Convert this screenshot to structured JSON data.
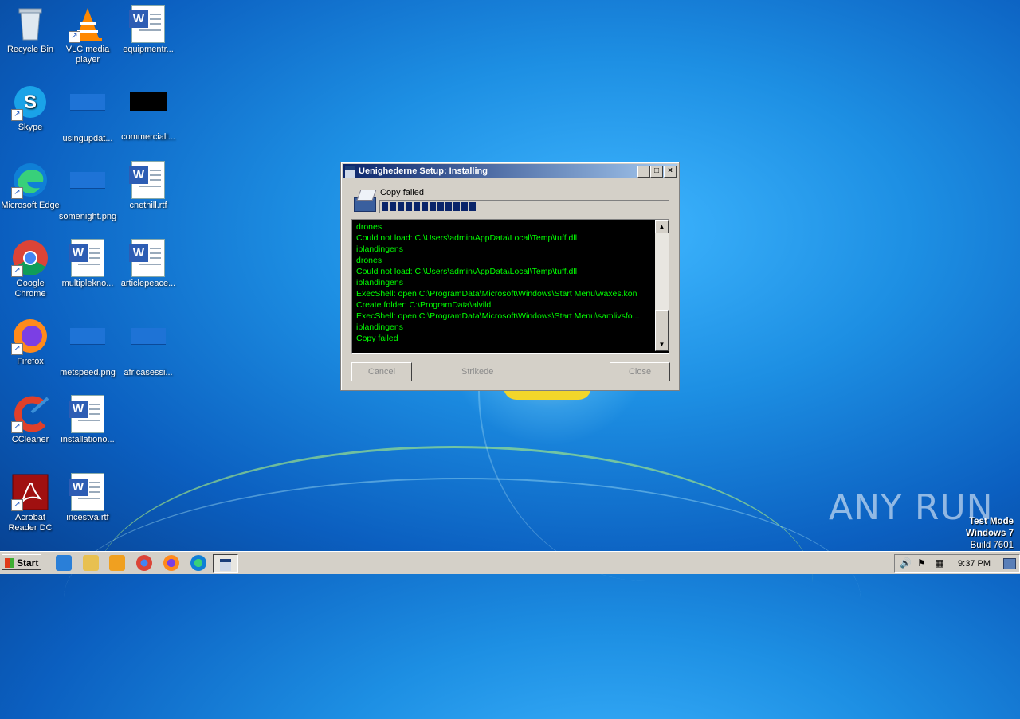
{
  "desktop": {
    "icons": [
      {
        "label": "Recycle Bin"
      },
      {
        "label": "VLC media player"
      },
      {
        "label": "equipmentr..."
      },
      {
        "label": "Skype"
      },
      {
        "label": "usingupdat..."
      },
      {
        "label": "commerciall..."
      },
      {
        "label": "Microsoft Edge"
      },
      {
        "label": "somenight.png"
      },
      {
        "label": "cnethill.rtf"
      },
      {
        "label": "Google Chrome"
      },
      {
        "label": "multiplekno..."
      },
      {
        "label": "articlepeace..."
      },
      {
        "label": "Firefox"
      },
      {
        "label": "metspeed.png"
      },
      {
        "label": "africasessi..."
      },
      {
        "label": "CCleaner"
      },
      {
        "label": "installationo..."
      },
      {
        "label": "Acrobat Reader DC"
      },
      {
        "label": "incestva.rtf"
      }
    ]
  },
  "setup_window": {
    "title": "Uenighederne Setup: Installing",
    "status": "Copy failed",
    "progress_fraction": 0.33,
    "log_lines": [
      "drones",
      "Could not load: C:\\Users\\admin\\AppData\\Local\\Temp\\tuff.dll",
      "iblandingens",
      "drones",
      "Could not load: C:\\Users\\admin\\AppData\\Local\\Temp\\tuff.dll",
      "iblandingens",
      "ExecShell: open C:\\ProgramData\\Microsoft\\Windows\\Start Menu\\waxes.kon",
      "Create folder: C:\\ProgramData\\alvild",
      "ExecShell: open C:\\ProgramData\\Microsoft\\Windows\\Start Menu\\samlivsfo...",
      "iblandingens",
      "Copy failed"
    ],
    "cancel_label": "Cancel",
    "brand_label": "Strikede",
    "close_label": "Close",
    "minimize_glyph": "_",
    "maximize_glyph": "□",
    "close_glyph": "×",
    "log_color": "#00ff00"
  },
  "taskbar": {
    "start_label": "Start",
    "clock": "9:37 PM",
    "pinned": [
      "internet-explorer-icon",
      "file-explorer-icon",
      "media-player-icon",
      "chrome-icon",
      "firefox-icon",
      "edge-icon"
    ]
  },
  "watermark": {
    "line1": "Test Mode",
    "line2": "Windows 7",
    "line3": "Build 7601",
    "logo": "ANY RUN"
  }
}
